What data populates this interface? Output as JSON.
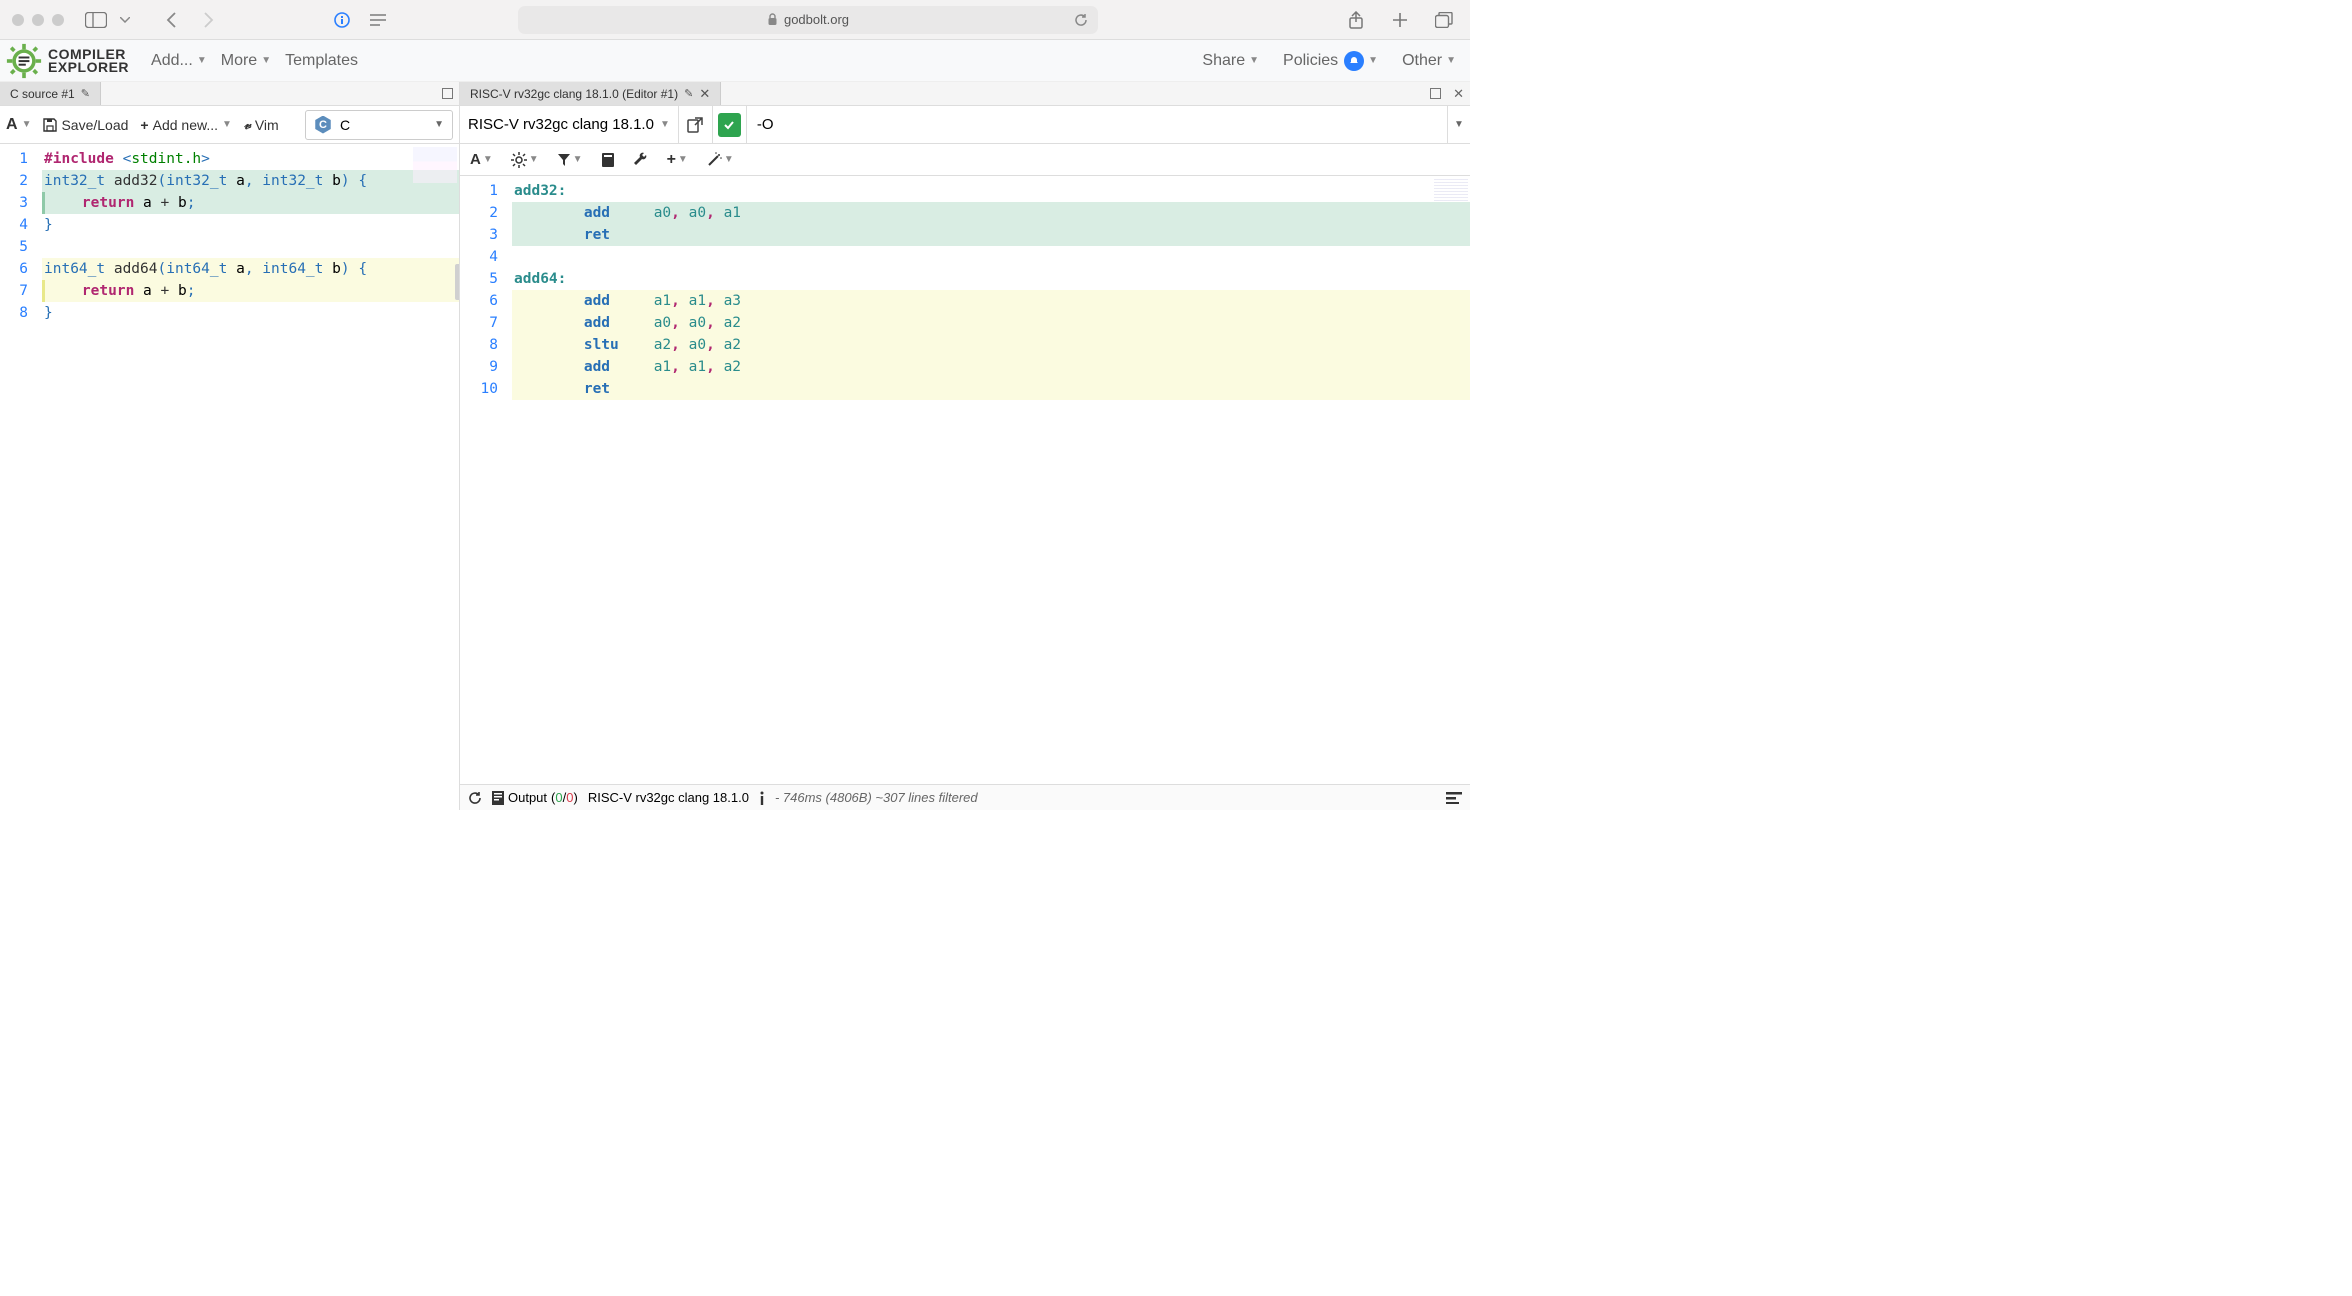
{
  "browser": {
    "url_host": "godbolt.org",
    "lock_icon": "lock"
  },
  "app": {
    "logo_line1": "COMPILER",
    "logo_line2": "EXPLORER",
    "nav": {
      "add": "Add...",
      "more": "More",
      "templates": "Templates",
      "share": "Share",
      "policies": "Policies",
      "other": "Other"
    }
  },
  "left_pane": {
    "tab_title": "C source #1",
    "toolbar": {
      "font": "A",
      "save_load": "Save/Load",
      "add_new": "Add new...",
      "vim": "Vim",
      "language": "C"
    },
    "lines": {
      "1": {
        "t": "#include <stdint.h>"
      },
      "2": {
        "t": "int32_t add32(int32_t a, int32_t b) {"
      },
      "3": {
        "t": "    return a + b;"
      },
      "4": {
        "t": "}"
      },
      "5": {
        "t": ""
      },
      "6": {
        "t": "int64_t add64(int64_t a, int64_t b) {"
      },
      "7": {
        "t": "    return a + b;"
      },
      "8": {
        "t": "}"
      }
    }
  },
  "right_pane": {
    "tab_title": "RISC-V rv32gc clang 18.1.0 (Editor #1)",
    "compiler_name": "RISC-V rv32gc clang 18.1.0",
    "flags": "-O",
    "asm_lines": {
      "1": {
        "t": "add32:"
      },
      "2": {
        "t": "        add     a0, a0, a1"
      },
      "3": {
        "t": "        ret"
      },
      "4": {
        "t": ""
      },
      "5": {
        "t": "add64:"
      },
      "6": {
        "t": "        add     a1, a1, a3"
      },
      "7": {
        "t": "        add     a0, a0, a2"
      },
      "8": {
        "t": "        sltu    a2, a0, a2"
      },
      "9": {
        "t": "        add     a1, a1, a2"
      },
      "10": {
        "t": "        ret"
      }
    },
    "status": {
      "output_label": "Output",
      "output_pass": "0",
      "output_fail": "0",
      "compiler": "RISC-V rv32gc clang 18.1.0",
      "timing": "- 746ms (4806B) ~307 lines filtered"
    }
  }
}
